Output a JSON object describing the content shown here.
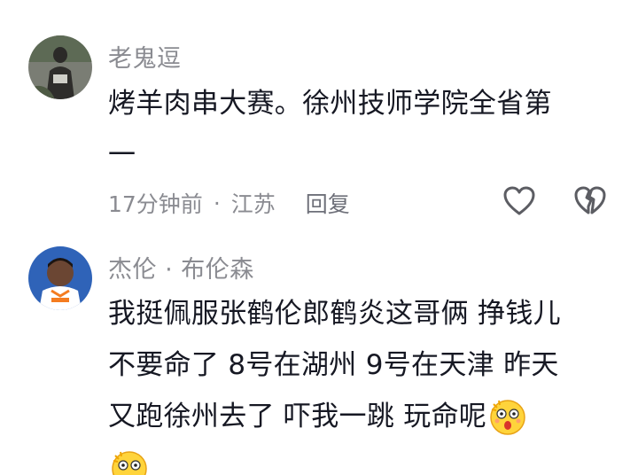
{
  "comments": [
    {
      "username": "老鬼逗",
      "lines": [
        "烤羊肉串大赛。徐州技师学院全省第",
        "一"
      ],
      "time": "17分钟前",
      "location": "江苏",
      "reply_label": "回复"
    },
    {
      "username": "杰伦 · 布伦森",
      "lines": [
        "我挺佩服张鹤伦郎鹤炎这哥俩  挣钱儿",
        "不要命了  8号在湖州  9号在天津  昨天",
        "又跑徐州去了  吓我一跳    玩命呢"
      ],
      "emojis": [
        "astonished-emoji",
        "astonished-emoji"
      ]
    }
  ],
  "icons": {
    "like": "heart-outline-icon",
    "dislike": "broken-heart-icon"
  },
  "colors": {
    "text": "#161823",
    "secondary": "#8a8b91",
    "jersey_blue": "#2f63b8",
    "jersey_orange": "#f47c20"
  }
}
